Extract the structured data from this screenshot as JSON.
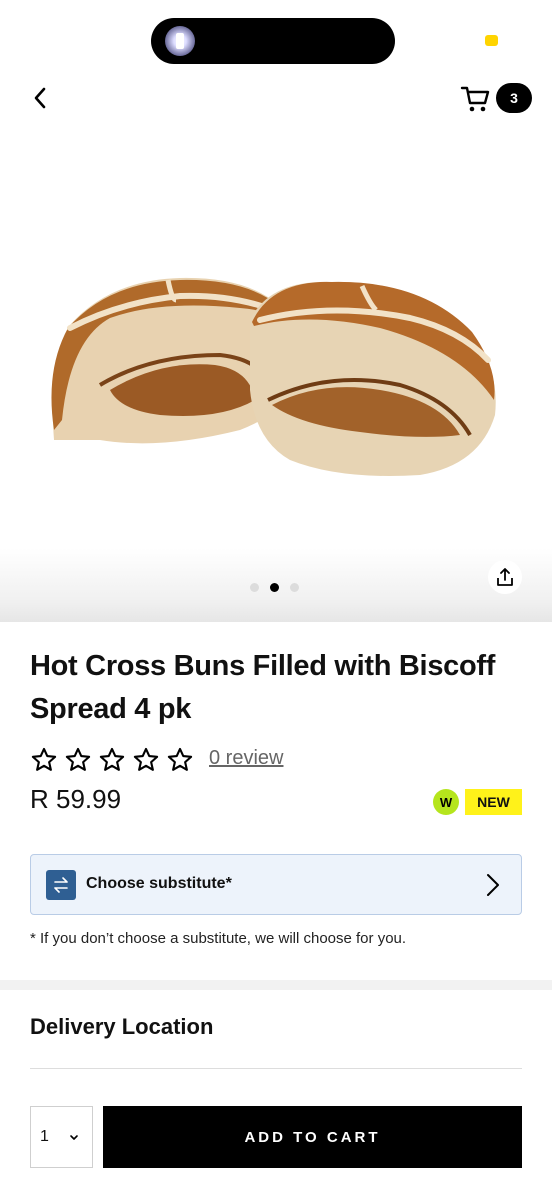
{
  "header": {
    "cart_count": "3",
    "back_icon": "chevron-left-icon",
    "cart_icon": "cart-icon"
  },
  "gallery": {
    "image_description": "Two halves of a hot cross bun filled with Biscoff spread",
    "page_count": 3,
    "active_page": 2,
    "share_icon": "share-icon"
  },
  "product": {
    "title": "Hot Cross Buns Filled with Biscoff Spread 4 pk",
    "rating": 0,
    "rating_max": 5,
    "review_text": "0 review",
    "price": "R 59.99",
    "w_badge": "W",
    "new_badge": "NEW"
  },
  "substitute": {
    "label": "Choose substitute*",
    "note": "* If you don’t choose a substitute, we will choose for you."
  },
  "delivery": {
    "title": "Delivery Location"
  },
  "purchase": {
    "quantity": "1",
    "add_to_cart": "ADD TO CART"
  },
  "colors": {
    "accent_yellow": "#fff21a",
    "w_green": "#b5e51d",
    "substitute_bg": "#edf3fb",
    "substitute_icon": "#2f5f93"
  }
}
